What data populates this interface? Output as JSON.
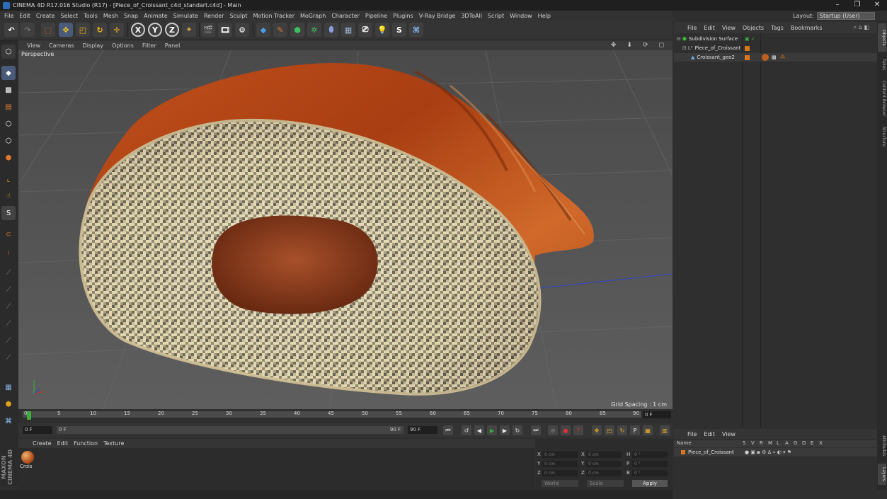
{
  "window": {
    "title": "CINEMA 4D R17.016 Studio (R17) - [Piece_of_Croissant_c4d_standart.c4d] - Main",
    "controls": [
      "–",
      "❐",
      "✕"
    ]
  },
  "menu": [
    "File",
    "Edit",
    "Create",
    "Select",
    "Tools",
    "Mesh",
    "Snap",
    "Animate",
    "Simulate",
    "Render",
    "Sculpt",
    "Motion Tracker",
    "MoGraph",
    "Character",
    "Pipeline",
    "Plugins",
    "V-Ray Bridge",
    "3DToAll",
    "Script",
    "Window",
    "Help"
  ],
  "layout": {
    "label": "Layout:",
    "value": "Startup (User)"
  },
  "toolbar": {
    "axis_buttons": [
      "X",
      "Y",
      "Z"
    ]
  },
  "viewport": {
    "menu": [
      "View",
      "Cameras",
      "Display",
      "Options",
      "Filter",
      "Panel"
    ],
    "camera_label": "Perspective",
    "grid_spacing": "Grid Spacing : 1 cm"
  },
  "timeline": {
    "ticks": [
      "0",
      "5",
      "10",
      "15",
      "20",
      "25",
      "30",
      "35",
      "40",
      "45",
      "50",
      "55",
      "60",
      "65",
      "70",
      "75",
      "80",
      "85",
      "90"
    ],
    "current_frame": "0 F"
  },
  "transport": {
    "start_field": "0 F",
    "slider_left": "0 F",
    "slider_right": "90 F",
    "end_field": "90 F"
  },
  "material_manager": {
    "menu": [
      "Create",
      "Edit",
      "Function",
      "Texture"
    ],
    "material_name": "Crois"
  },
  "coordinates": {
    "rows": [
      {
        "a": "X",
        "av": "0 cm",
        "b": "X",
        "bv": "0 cm",
        "c": "H",
        "cv": "0 °"
      },
      {
        "a": "Y",
        "av": "0 cm",
        "b": "Y",
        "bv": "0 cm",
        "c": "P",
        "cv": "0 °"
      },
      {
        "a": "Z",
        "av": "0 cm",
        "b": "Z",
        "bv": "0 cm",
        "c": "B",
        "cv": "0 °"
      }
    ],
    "mode": "World",
    "transform": "Scale",
    "apply_label": "Apply"
  },
  "brand": "MAXON CINEMA 4D",
  "object_manager": {
    "menu": [
      "File",
      "Edit",
      "View",
      "Objects",
      "Tags",
      "Bookmarks"
    ],
    "objects": [
      {
        "name": "Subdivision Surface",
        "color": "#3fb83f"
      },
      {
        "name": "Piece_of_Croissant",
        "color": "#bbbbbb"
      },
      {
        "name": "Croissant_geo2",
        "color": "#6fb0e6"
      }
    ]
  },
  "attributes": {
    "menu": [
      "File",
      "Edit",
      "View"
    ],
    "columns": [
      "Name",
      "S",
      "V",
      "R",
      "M",
      "L",
      "A",
      "G",
      "D",
      "E",
      "X"
    ],
    "row_name": "Piece_of_Croissant"
  },
  "right_tabs": [
    "Objects",
    "Takes",
    "Content Browser",
    "Structure",
    "Attributes",
    "Layers"
  ],
  "colors": {
    "accent": "#2c6fb8",
    "green": "#3cae3c",
    "orange": "#d9761e"
  }
}
